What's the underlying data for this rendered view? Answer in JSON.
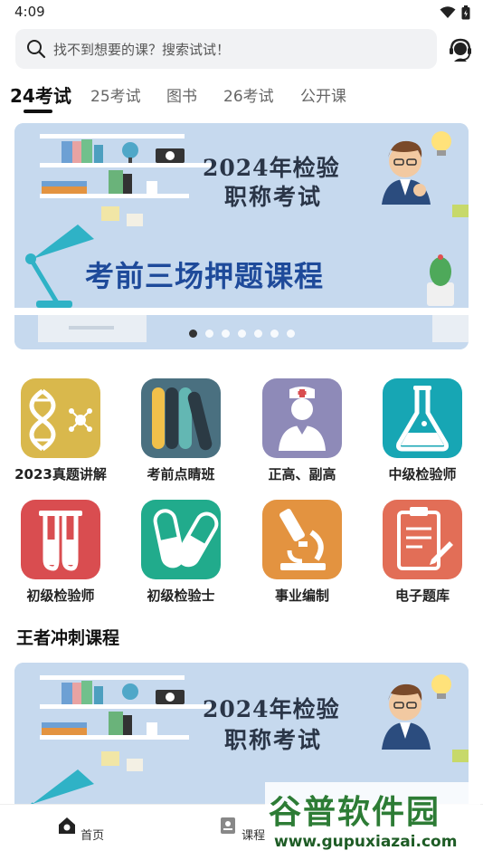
{
  "status": {
    "time": "4:09"
  },
  "search": {
    "placeholder_text": "找不到想要的课？搜索试试！"
  },
  "tabs": [
    {
      "label": "24考试",
      "active": true
    },
    {
      "label": "25考试"
    },
    {
      "label": "图书"
    },
    {
      "label": "26考试"
    },
    {
      "label": "公开课"
    }
  ],
  "banner": {
    "line1": "2024年检验",
    "line2": "职称考试",
    "main": "考前三场押题课程",
    "dot_count": 7,
    "active_dot": 0
  },
  "grid": [
    {
      "label": "2023真题讲解",
      "icon": "dna-icon",
      "color": "#d9b84c"
    },
    {
      "label": "考前点睛班",
      "icon": "books-icon",
      "color": "#4a7080"
    },
    {
      "label": "正高、副高",
      "icon": "doctor-icon",
      "color": "#8e8ab8"
    },
    {
      "label": "中级检验师",
      "icon": "flask-icon",
      "color": "#17a6b4"
    },
    {
      "label": "初级检验师",
      "icon": "test-tubes-icon",
      "color": "#d94d50"
    },
    {
      "label": "初级检验士",
      "icon": "capsules-icon",
      "color": "#21ab8c"
    },
    {
      "label": "事业编制",
      "icon": "microscope-icon",
      "color": "#e39340"
    },
    {
      "label": "电子题库",
      "icon": "clipboard-icon",
      "color": "#e26e57"
    }
  ],
  "section": {
    "title": "王者冲刺课程"
  },
  "banner2": {
    "line1": "2024年检验",
    "line2": "职称考试"
  },
  "nav": [
    {
      "label": "首页",
      "icon": "home-icon"
    },
    {
      "label": "课程",
      "icon": "course-icon"
    }
  ],
  "watermark": {
    "text": "谷普软件园",
    "url": "www.gupuxiazai.com"
  }
}
